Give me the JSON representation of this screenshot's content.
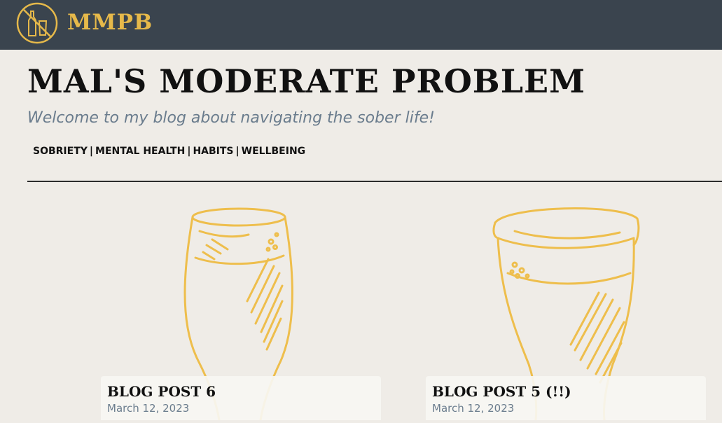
{
  "header": {
    "brand": "MMPB",
    "logo_icon": "no-alcohol-icon"
  },
  "blog": {
    "title": "MAL'S MODERATE PROBLEM",
    "subtitle": "Welcome to my blog about navigating the sober life!"
  },
  "topics": [
    {
      "label": "SOBRIETY"
    },
    {
      "label": "MENTAL HEALTH"
    },
    {
      "label": "HABITS"
    },
    {
      "label": "WELLBEING"
    }
  ],
  "topic_separator": "|",
  "posts": [
    {
      "title": "BLOG POST 6",
      "date": "March 12, 2023",
      "image_icon": "wine-glass-illustration"
    },
    {
      "title": "BLOG POST 5 (!!)",
      "date": "March 12, 2023",
      "image_icon": "pint-glass-illustration"
    }
  ],
  "colors": {
    "header_bg": "#3a444e",
    "accent": "#e6b94a",
    "page_bg": "#efece7",
    "subtitle": "#6a7c8d"
  }
}
